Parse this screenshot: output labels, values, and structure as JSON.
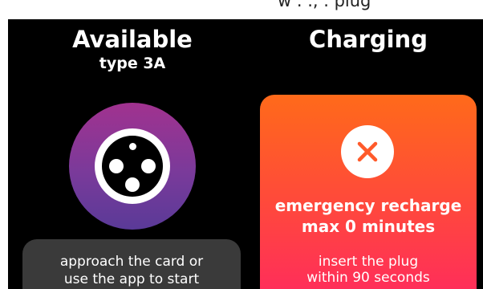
{
  "top_strip": {
    "text": "w . ., .  plug"
  },
  "available": {
    "title": "Available",
    "type": "type 3A",
    "message_line1": "approach the card or",
    "message_line2": "use the app to start"
  },
  "charging": {
    "title": "Charging",
    "emergency_line1": "emergency recharge",
    "emergency_line2": "max 0 minutes",
    "instruction_line1": "insert the plug",
    "instruction_line2": "within 90 seconds"
  },
  "colors": {
    "background": "#000000",
    "accent_orange": "#ff6a1a",
    "accent_pink": "#ff2a5e",
    "connector_purple": "#a1328f",
    "message_box_gray": "#3a3a3a"
  },
  "icons": {
    "connector": "type-3a-socket-icon",
    "error": "x-icon"
  }
}
